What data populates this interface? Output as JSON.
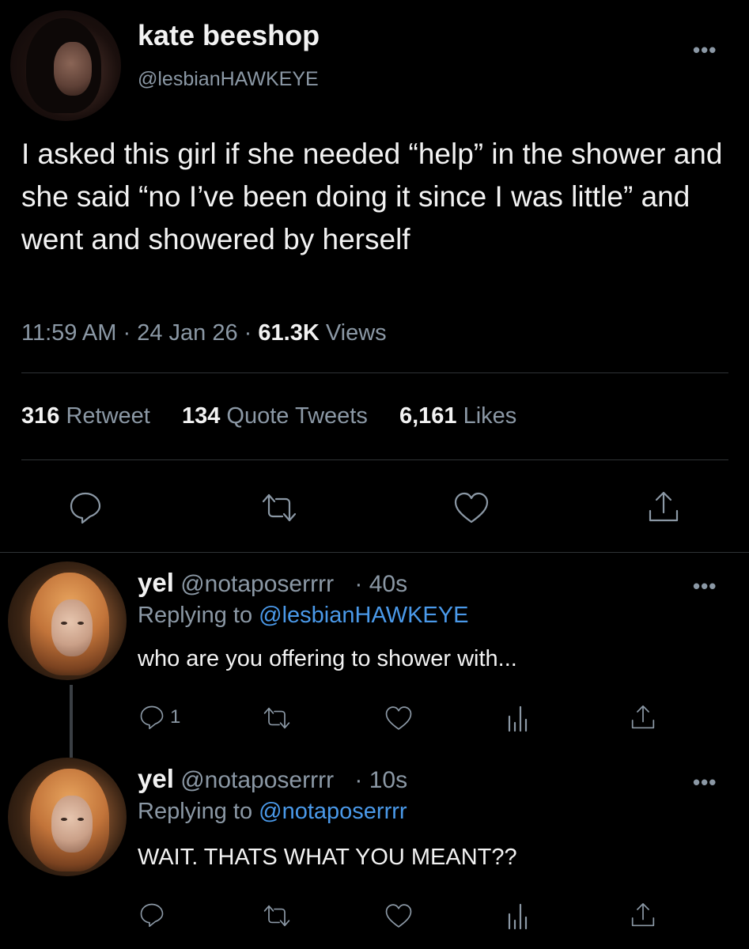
{
  "tweet": {
    "author_name": "kate beeshop",
    "author_handle": "@lesbianHAWKEYE",
    "more": "•••",
    "text": "I asked this girl if she needed “help” in the shower and she said “no I’ve been doing it since I was little” and went and showered by herself",
    "time": "11:59 AM",
    "sep1": "·",
    "date": "24 Jan 26",
    "sep2": "·",
    "views_count": "61.3K",
    "views_label": "Views",
    "retweet_count": "316",
    "retweet_label": "Retweet",
    "quote_count": "134",
    "quote_label": "Quote Tweets",
    "likes_count": "6,161",
    "likes_label": "Likes"
  },
  "replies": [
    {
      "name": "yel",
      "handle": "@notaposerrrr",
      "time": "· 40s",
      "replying_prefix": "Replying to",
      "replying_to": "@lesbianHAWKEYE",
      "text": "who are you offering to shower with...",
      "reply_count": "1",
      "more": "•••"
    },
    {
      "name": "yel",
      "handle": "@notaposerrrr",
      "time": "· 10s",
      "replying_prefix": "Replying to",
      "replying_to": "@notaposerrrr",
      "text": "WAIT. THATS WHAT YOU MEANT??",
      "reply_count": "",
      "more": "•••"
    }
  ],
  "icons": [
    "reply-icon",
    "retweet-icon",
    "like-icon",
    "share-icon",
    "analytics-icon"
  ],
  "colors": {
    "background": "#000000",
    "text": "#e7e9ea",
    "muted": "#8b98a5",
    "link": "#4a99e9",
    "divider": "#2f3336"
  }
}
